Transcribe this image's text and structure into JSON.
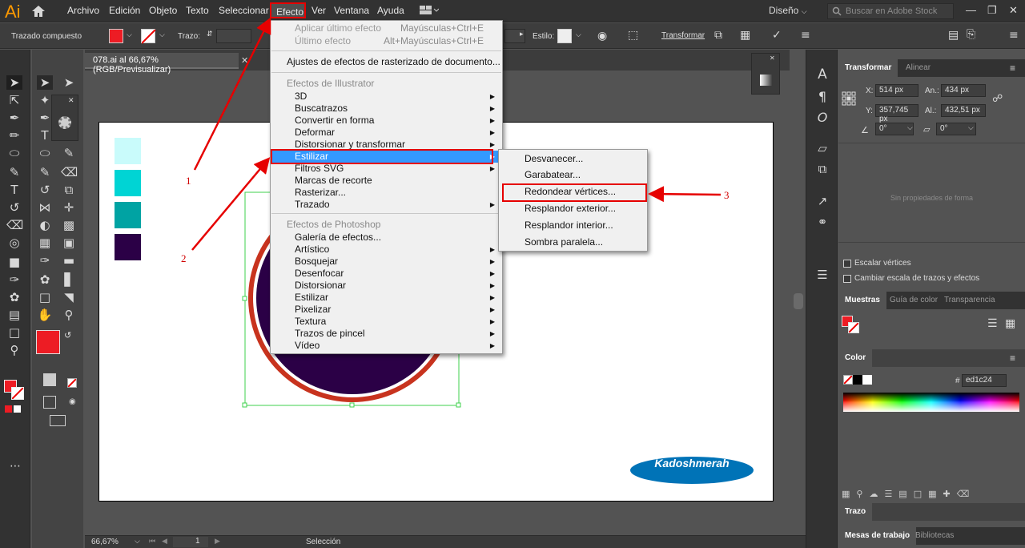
{
  "app": {
    "logo": "Ai"
  },
  "menubar": {
    "items": [
      "Archivo",
      "Edición",
      "Objeto",
      "Texto",
      "Seleccionar",
      "Efecto",
      "Ver",
      "Ventana",
      "Ayuda"
    ],
    "workspace": "Diseño",
    "search_placeholder": "Buscar en Adobe Stock"
  },
  "control_bar": {
    "label": "Trazado compuesto",
    "stroke_label": "Trazo:",
    "style_label": "Estilo:",
    "transform_label": "Transformar"
  },
  "document": {
    "tab_title": "078.ai al 66,67% (RGB/Previsualizar)",
    "swatches": [
      "#c9fbfb",
      "#00d4d4",
      "#00a3a3",
      "#2b0046"
    ],
    "logo_text": "Kadoshmerah"
  },
  "effect_menu": {
    "apply_last": "Aplicar último efecto",
    "apply_last_shortcut": "Mayúsculas+Ctrl+E",
    "last": "Último efecto",
    "last_shortcut": "Alt+Mayúsculas+Ctrl+E",
    "raster_settings": "Ajustes de efectos de rasterizado de documento...",
    "illustrator_header": "Efectos de Illustrator",
    "illustrator_items": [
      "3D",
      "Buscatrazos",
      "Convertir en forma",
      "Deformar",
      "Distorsionar y transformar",
      "Estilizar",
      "Filtros SVG",
      "Marcas de recorte",
      "Rasterizar...",
      "Trazado"
    ],
    "photoshop_header": "Efectos de Photoshop",
    "photoshop_items": [
      "Galería de efectos...",
      "Artístico",
      "Bosquejar",
      "Desenfocar",
      "Distorsionar",
      "Estilizar",
      "Pixelizar",
      "Textura",
      "Trazos de pincel",
      "Vídeo"
    ]
  },
  "stylize_submenu": {
    "items": [
      "Desvanecer...",
      "Garabatear...",
      "Redondear vértices...",
      "Resplandor exterior...",
      "Resplandor interior...",
      "Sombra paralela..."
    ]
  },
  "annotations": {
    "one": "1",
    "two": "2",
    "three": "3"
  },
  "transform_panel": {
    "tab_active": "Transformar",
    "tab_other": "Alinear",
    "x_label": "X:",
    "x": "514 px",
    "y_label": "Y:",
    "y": "357,745 px",
    "w_label": "An.:",
    "w": "434 px",
    "h_label": "Al.:",
    "h": "432,51 px",
    "angle": "0°",
    "shear": "0°",
    "no_shape": "Sin propiedades de forma",
    "scale_corners": "Escalar vértices",
    "scale_strokes": "Cambiar escala de trazos y efectos"
  },
  "swatches_panel": {
    "tabs": [
      "Muestras",
      "Guía de color",
      "Transparencia"
    ]
  },
  "color_panel": {
    "title": "Color",
    "hex_label": "#",
    "hex": "ed1c24"
  },
  "stroke_panel": {
    "title": "Trazo"
  },
  "bottom_panel": {
    "tabs": [
      "Mesas de trabajo",
      "Bibliotecas"
    ]
  },
  "status": {
    "zoom": "66,67%",
    "page": "1",
    "tool": "Selección"
  },
  "colors": {
    "fill": "#ed1c24",
    "accent": "#3399ff",
    "annotation": "#e60000"
  }
}
